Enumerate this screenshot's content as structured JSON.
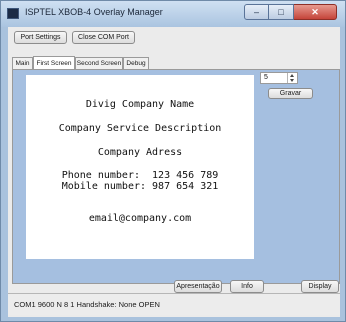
{
  "window": {
    "title": "ISPTEL XBOB-4 Overlay Manager",
    "icon": "app-icon",
    "controls": {
      "minimize": "–",
      "maximize": "□",
      "close": "✕"
    }
  },
  "toolbar": {
    "port_settings_label": "Port Settings",
    "close_com_port_label": "Close COM Port"
  },
  "tabs": [
    "Main",
    "First Screen",
    "Second Screen",
    "Debug"
  ],
  "active_tab": "First Screen",
  "screen": {
    "lines": [
      "Divig Company Name",
      "Company Service Description",
      "Company Adress",
      "Phone number:  123 456 789",
      "Mobile number: 987 654 321",
      "email@company.com"
    ]
  },
  "spinner": {
    "value": "5"
  },
  "buttons": {
    "gravar": "Gravar",
    "apresentacao": "Apresentação",
    "info": "Info",
    "display": "Display"
  },
  "status": {
    "text": "COM1  9600  N 8 1  Handshake: None  OPEN"
  }
}
